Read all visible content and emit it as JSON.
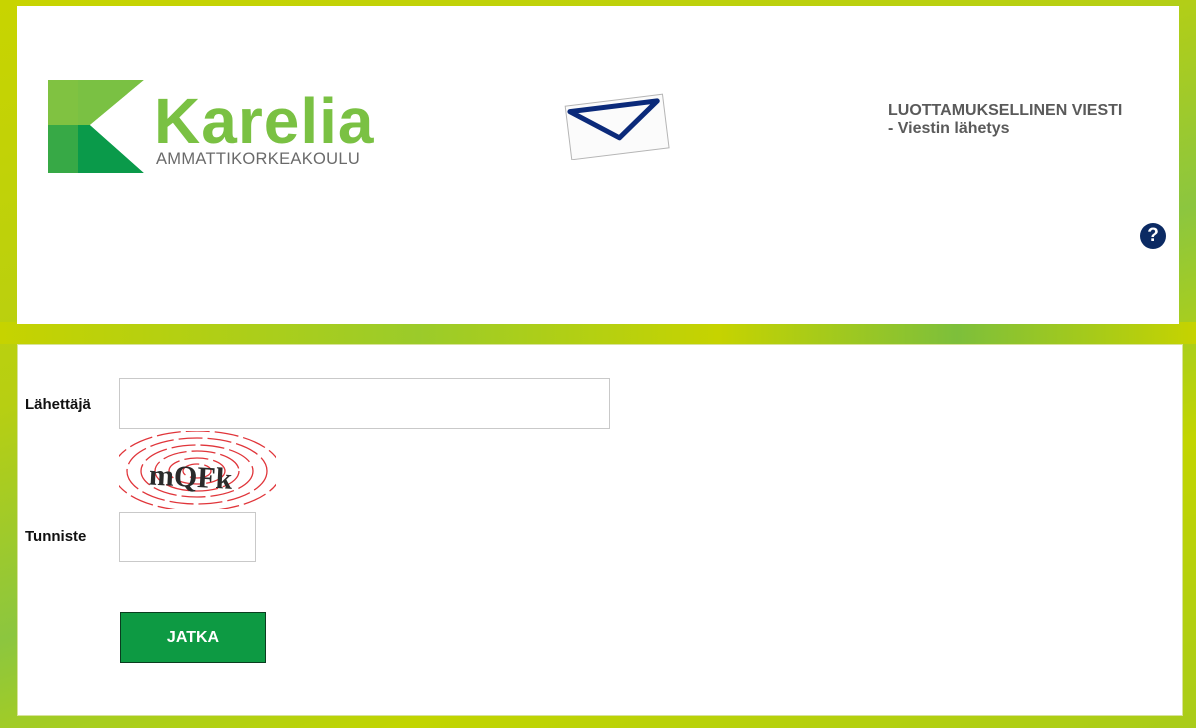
{
  "header": {
    "logo": {
      "brand_name": "Karelia",
      "brand_subtitle": "AMMATTIKORKEAKOULU"
    },
    "title_line1": "LUOTTAMUKSELLINEN VIESTI",
    "title_line2": "- Viestin lähetys",
    "help_symbol": "?"
  },
  "form": {
    "sender": {
      "label": "Lähettäjä",
      "value": ""
    },
    "captcha": {
      "text": "mQFk"
    },
    "identifier": {
      "label": "Tunniste",
      "value": ""
    },
    "submit_label": "JATKA"
  },
  "colors": {
    "brand_green": "#7ac143",
    "brand_dark_green": "#0a9a4a",
    "background_lime": "#c8d400",
    "help_navy": "#0b2a63",
    "button_green": "#0d9a43"
  },
  "icons": [
    "envelope-icon",
    "help-icon"
  ]
}
